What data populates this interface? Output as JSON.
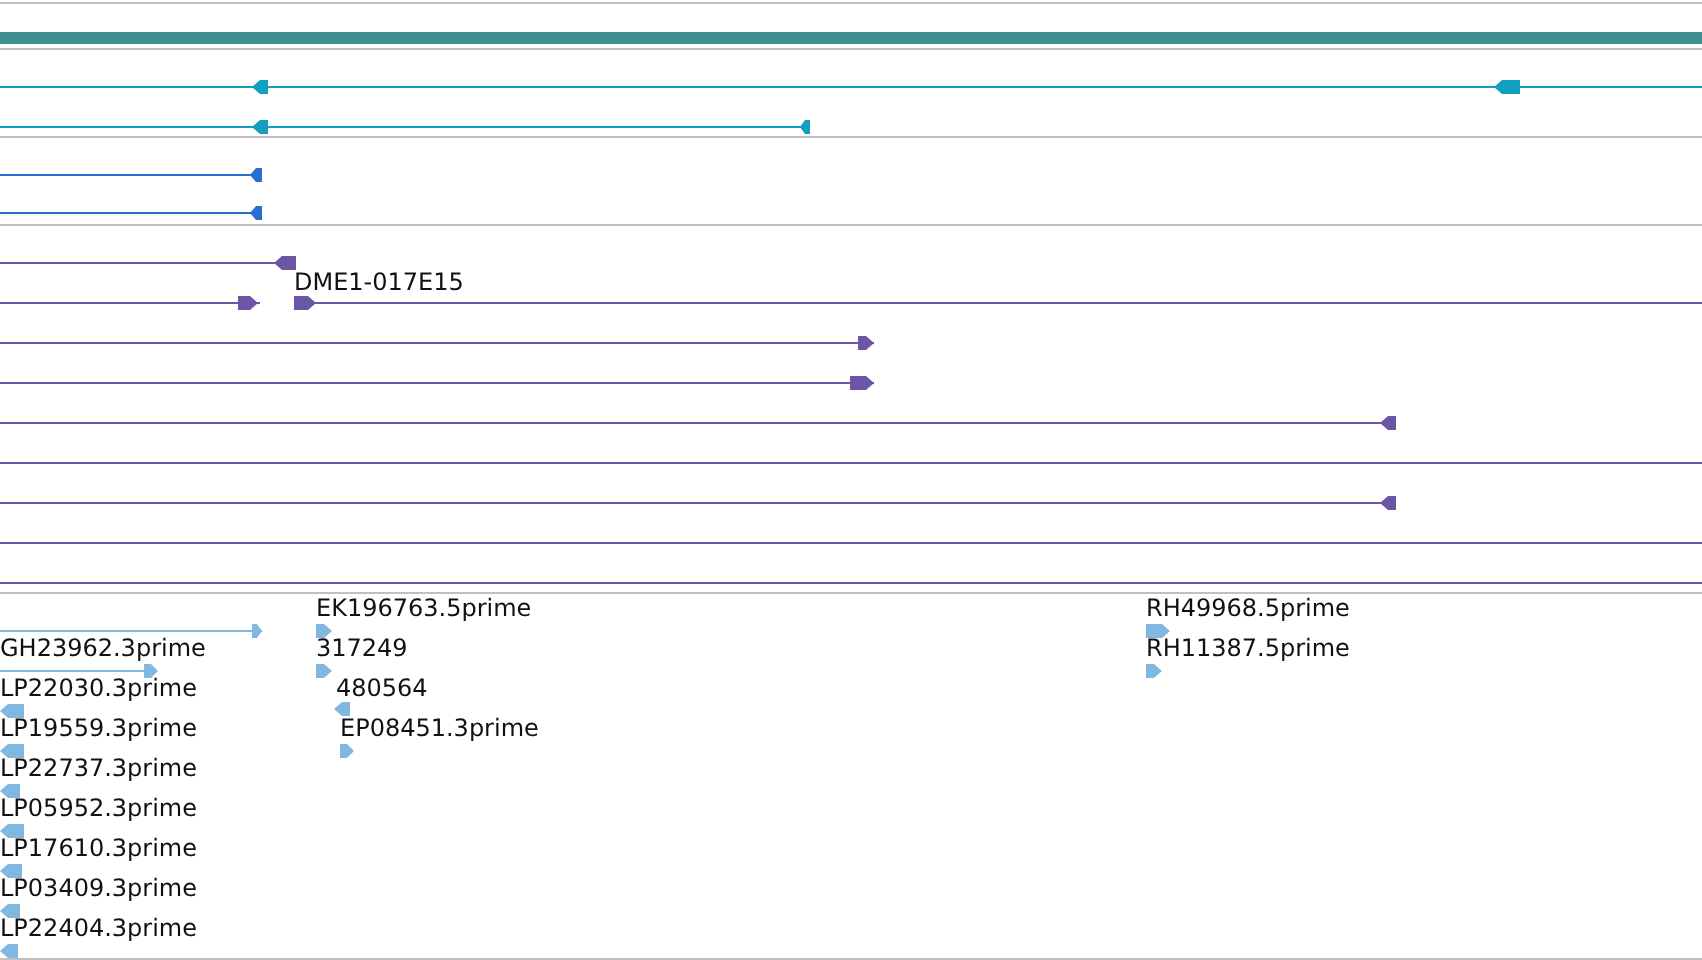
{
  "tracks": [
    {
      "kind": "gene",
      "color": "#129fc0",
      "rows": [
        {
          "kind": "arrowed",
          "reverse": true
        },
        {
          "kind": "arrowed",
          "reverse": true
        }
      ]
    },
    {
      "kind": "gene",
      "color": "#2a6fcf",
      "rows": [
        {
          "kind": "arrowed",
          "reverse": true
        },
        {
          "kind": "arrowed",
          "reverse": true
        }
      ]
    },
    {
      "kind": "gene",
      "color": "#6b55a5",
      "rows": [
        {
          "kind": "arrowed",
          "reverse": true
        },
        {
          "kind": "arrowed",
          "reverse": false,
          "label": "DME1-017E15"
        },
        {
          "kind": "arrowed",
          "reverse": false
        },
        {
          "kind": "arrowed",
          "reverse": false
        },
        {
          "kind": "arrowed",
          "reverse": true
        },
        {
          "kind": "plain"
        },
        {
          "kind": "arrowed",
          "reverse": true
        },
        {
          "kind": "plain"
        },
        {
          "kind": "plain"
        }
      ]
    }
  ],
  "est_features": [
    {
      "reverse": false
    },
    {
      "label": "GH23962.3prime",
      "reverse": false
    },
    {
      "label": "LP22030.3prime",
      "reverse": true
    },
    {
      "label": "LP19559.3prime",
      "reverse": true
    },
    {
      "label": "LP22737.3prime",
      "reverse": true
    },
    {
      "label": "LP05952.3prime",
      "reverse": true
    },
    {
      "label": "LP17610.3prime",
      "reverse": true
    },
    {
      "label": "LP03409.3prime",
      "reverse": true
    },
    {
      "label": "LP22404.3prime",
      "reverse": true
    },
    {
      "label": "EK196763.5prime",
      "reverse": false
    },
    {
      "label": "317249",
      "reverse": false
    },
    {
      "label": "480564",
      "reverse": true
    },
    {
      "label": "EP08451.3prime",
      "reverse": false
    },
    {
      "label": "RH49968.5prime",
      "reverse": false
    },
    {
      "label": "RH11387.5prime",
      "reverse": false
    }
  ]
}
